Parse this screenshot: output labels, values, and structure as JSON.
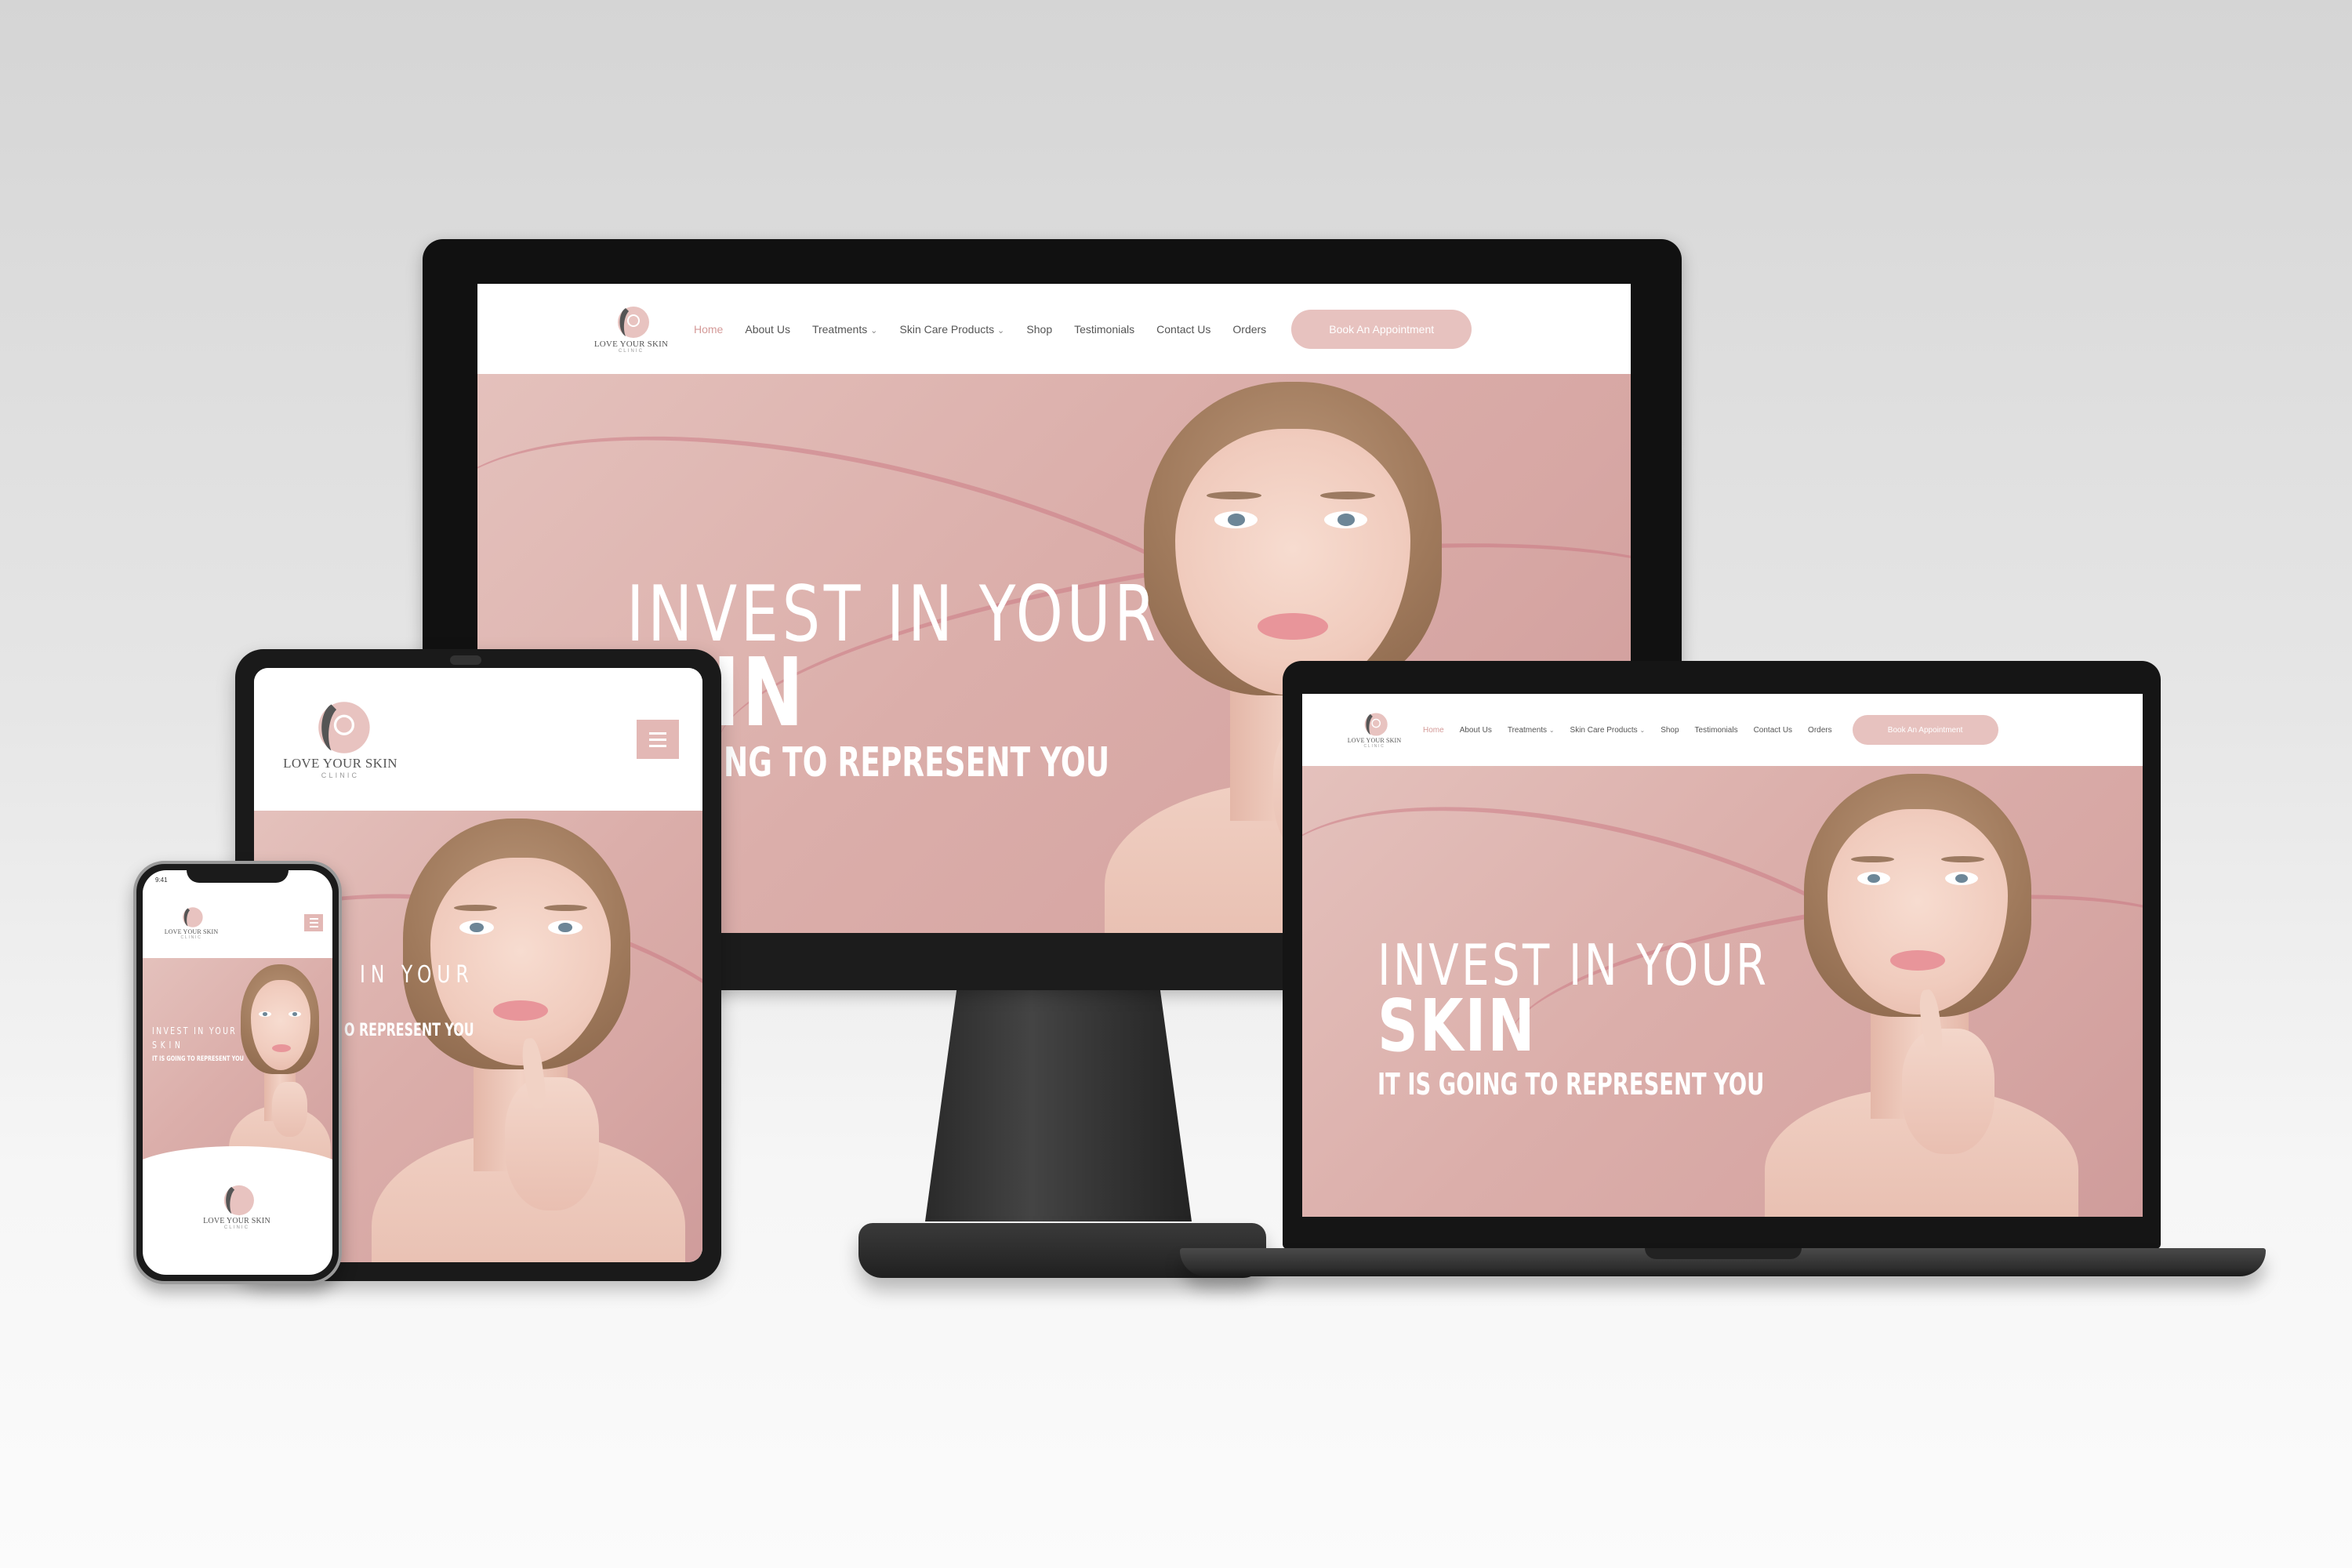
{
  "site": {
    "logo": {
      "name": "LOVE YOUR SKIN",
      "sub": "CLINIC"
    },
    "nav": [
      {
        "label": "Home",
        "active": true,
        "dropdown": false
      },
      {
        "label": "About Us",
        "active": false,
        "dropdown": false
      },
      {
        "label": "Treatments",
        "active": false,
        "dropdown": true
      },
      {
        "label": "Skin Care Products",
        "active": false,
        "dropdown": true
      },
      {
        "label": "Shop",
        "active": false,
        "dropdown": false
      },
      {
        "label": "Testimonials",
        "active": false,
        "dropdown": false
      },
      {
        "label": "Contact Us",
        "active": false,
        "dropdown": false
      },
      {
        "label": "Orders",
        "active": false,
        "dropdown": false
      }
    ],
    "cta": "Book An Appointment",
    "hero": {
      "line1": "INVEST IN YOUR",
      "line2": "SKIN",
      "line3": "IT IS GOING TO REPRESENT YOU"
    },
    "tablet_hero": {
      "line1": "IN YOUR",
      "line3": "O REPRESENT YOU"
    },
    "monitor_hero_partial": {
      "line2": "IN",
      "line3": "ING TO REPRESENT YOU"
    },
    "phone_hero": {
      "line3": "IT IS GOING TO REPRESENT YOU"
    },
    "phone_status_time": "9:41"
  },
  "colors": {
    "accent_pink": "#d49a98",
    "button_pink": "#e7c2bf",
    "hero_pink": "#dbaeaa"
  }
}
